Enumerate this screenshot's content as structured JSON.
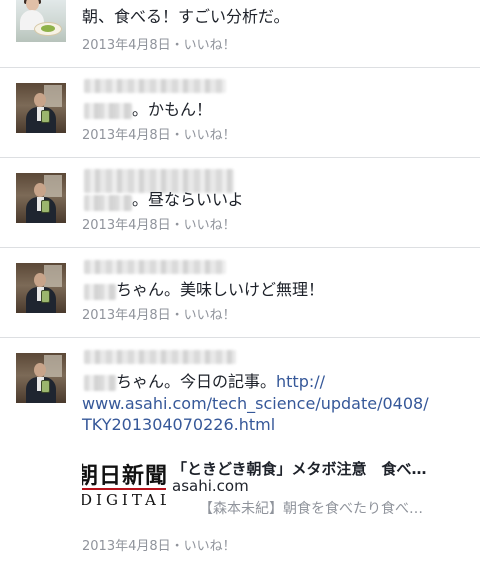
{
  "comments": [
    {
      "text": "朝、食べる！すごい分析だ。",
      "date": "2013年4月8日",
      "separator": "・",
      "like": "いいね！"
    },
    {
      "text": "。かもん！",
      "date": "2013年4月8日",
      "separator": "・",
      "like": "いいね！"
    },
    {
      "text": "。昼ならいいよ",
      "date": "2013年4月8日",
      "separator": "・",
      "like": "いいね！"
    },
    {
      "text": "ちゃん。美味しいけど無理！",
      "date": "2013年4月8日",
      "separator": "・",
      "like": "いいね！"
    },
    {
      "text_line1_prefix": "ちゃん。今日の記事。",
      "link_line1": "http://",
      "link_line2": "www.asahi.com/tech_science/update/0408/",
      "link_line3": "TKY201304070226.html",
      "date": "2013年4月8日",
      "separator": "・",
      "like": "いいね！",
      "preview": {
        "thumb_line1": "朝日新聞",
        "thumb_line2": "DIGITAL",
        "title": "「ときどき朝食」メタボ注意　食べ…",
        "domain": "asahi.com",
        "description": "【森本未紀】朝食を食べたり食べ…"
      }
    }
  ],
  "colors": {
    "link": "#365899",
    "meta": "#90949c",
    "divider": "#dddfe2",
    "logo_rule": "#b5121b"
  }
}
